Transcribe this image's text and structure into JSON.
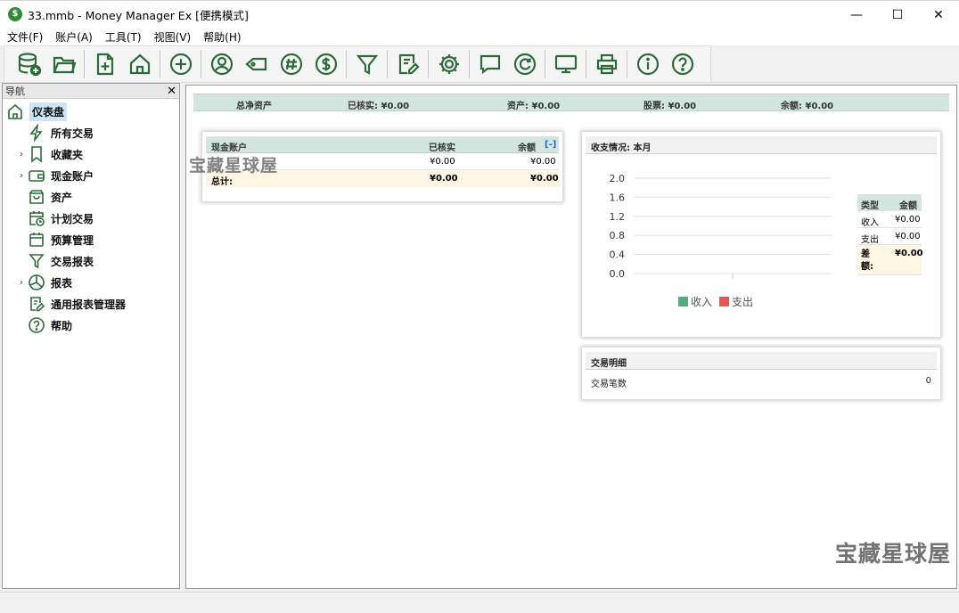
{
  "window": {
    "title": "33.mmb - Money Manager Ex [便携模式]",
    "app_icon_glyph": "$",
    "minimize_glyph": "—",
    "maximize_glyph": "☐",
    "close_glyph": "✕"
  },
  "menu": [
    "文件(F)",
    "账户(A)",
    "工具(T)",
    "视图(V)",
    "帮助(H)"
  ],
  "toolbar": {
    "icon_color": "#2e6b3a",
    "buttons": [
      "new-database-icon",
      "open-folder-icon",
      "new-document-icon",
      "home-icon",
      "add-transaction-icon",
      "payee-icon",
      "tag-icon",
      "category-icon",
      "currency-icon",
      "filter-icon",
      "report-editor-icon",
      "settings-icon",
      "chat-icon",
      "refresh-icon",
      "monitor-icon",
      "print-icon",
      "info-icon",
      "help-icon"
    ]
  },
  "nav": {
    "header": "导航",
    "close_glyph": "✕",
    "items": [
      {
        "label": "仪表盘",
        "icon": "home-icon",
        "level": 0,
        "expandable": false,
        "selected": true
      },
      {
        "label": "所有交易",
        "icon": "lightning-icon",
        "level": 1,
        "expandable": false
      },
      {
        "label": "收藏夹",
        "icon": "bookmark-icon",
        "level": 1,
        "expandable": true
      },
      {
        "label": "现金账户",
        "icon": "wallet-icon",
        "level": 1,
        "expandable": true
      },
      {
        "label": "资产",
        "icon": "bag-icon",
        "level": 1,
        "expandable": false
      },
      {
        "label": "计划交易",
        "icon": "calendar-clock-icon",
        "level": 1,
        "expandable": false
      },
      {
        "label": "预算管理",
        "icon": "calendar-icon",
        "level": 1,
        "expandable": false
      },
      {
        "label": "交易报表",
        "icon": "filter-icon",
        "level": 1,
        "expandable": false
      },
      {
        "label": "报表",
        "icon": "pie-chart-icon",
        "level": 1,
        "expandable": true
      },
      {
        "label": "通用报表管理器",
        "icon": "report-editor-icon",
        "level": 1,
        "expandable": false
      },
      {
        "label": "帮助",
        "icon": "help-icon",
        "level": 1,
        "expandable": false
      }
    ]
  },
  "summary": {
    "net_assets": "总净资产",
    "reconciled": "已核实: ¥0.00",
    "assets": "资产: ¥0.00",
    "stocks": "股票: ¥0.00",
    "balance": "余额: ¥0.00"
  },
  "accounts": {
    "header": {
      "name": "现金账户",
      "reconciled": "已核实",
      "balance": "余额",
      "collapse": "[-]"
    },
    "rows": [
      {
        "name": "",
        "reconciled": "¥0.00",
        "balance": "¥0.00"
      }
    ],
    "total": {
      "name": "总计:",
      "reconciled": "¥0.00",
      "balance": "¥0.00"
    }
  },
  "income_expense": {
    "title": "收支情况:  本月",
    "table": {
      "header_type": "类型",
      "header_amount": "金额",
      "income_label": "收入",
      "income_value": "¥0.00",
      "expense_label": "支出",
      "expense_value": "¥0.00",
      "diff_label": "差额:",
      "diff_value": "¥0.00"
    }
  },
  "chart_data": {
    "type": "bar",
    "categories": [
      ""
    ],
    "series": [
      {
        "name": "收入",
        "values": [
          0
        ],
        "color": "#4caf7d"
      },
      {
        "name": "支出",
        "values": [
          0
        ],
        "color": "#ef5350"
      }
    ],
    "ylim": [
      0,
      2.0
    ],
    "yticks": [
      "0.0",
      "0.4",
      "0.8",
      "1.2",
      "1.6",
      "2.0"
    ],
    "grid": true,
    "legend": "bottom"
  },
  "transactions": {
    "title": "交易明细",
    "count_label": "交易笔数",
    "count_value": "0"
  },
  "watermark": "宝藏星球屋"
}
